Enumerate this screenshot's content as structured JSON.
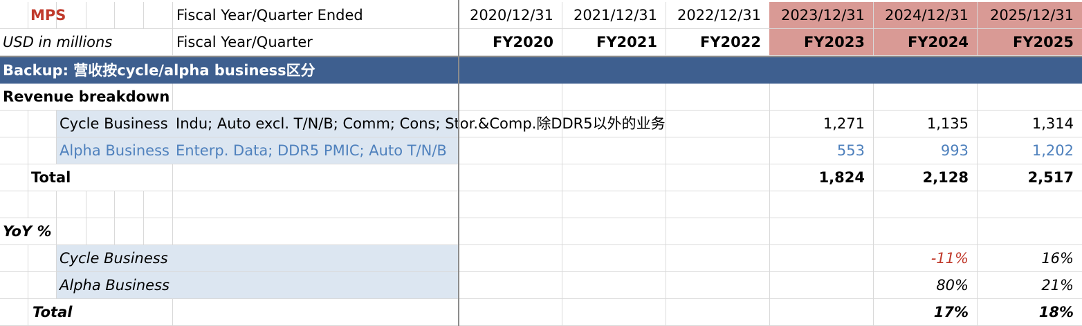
{
  "header": {
    "company": "MPS",
    "units": "USD in millions",
    "label_date": "Fiscal Year/Quarter Ended",
    "label_fy": "Fiscal Year/Quarter",
    "dates": [
      "2020/12/31",
      "2021/12/31",
      "2022/12/31",
      "2023/12/31",
      "2024/12/31",
      "2025/12/31"
    ],
    "fys": [
      "FY2020",
      "FY2021",
      "FY2022",
      "FY2023",
      "FY2024",
      "FY2025"
    ]
  },
  "section_title": "Backup: 营收按cycle/alpha business区分",
  "revenue": {
    "title": "Revenue breakdown",
    "cycle": {
      "label": "Cycle Business",
      "desc": "Indu; Auto excl. T/N/B; Comm; Cons; Stor.&Comp.除DDR5以外的业务",
      "values": [
        "1,271",
        "1,135",
        "1,314"
      ]
    },
    "alpha": {
      "label": "Alpha Business",
      "desc": "Enterp. Data; DDR5 PMIC; Auto T/N/B",
      "values": [
        "553",
        "993",
        "1,202"
      ]
    },
    "total": {
      "label": "Total",
      "values": [
        "1,824",
        "2,128",
        "2,517"
      ]
    }
  },
  "yoy": {
    "title": "YoY %",
    "cycle": {
      "label": "Cycle Business",
      "values": [
        "-11%",
        "16%"
      ]
    },
    "alpha": {
      "label": "Alpha Business",
      "values": [
        "80%",
        "21%"
      ]
    },
    "total": {
      "label": "Total",
      "values": [
        "17%",
        "18%"
      ]
    }
  },
  "colors": {
    "highlight_header": "#d99a95",
    "section_band": "#3e5f8f",
    "light_band": "#dce6f1",
    "alpha_text": "#4f81bd",
    "negative": "#c0392b"
  }
}
